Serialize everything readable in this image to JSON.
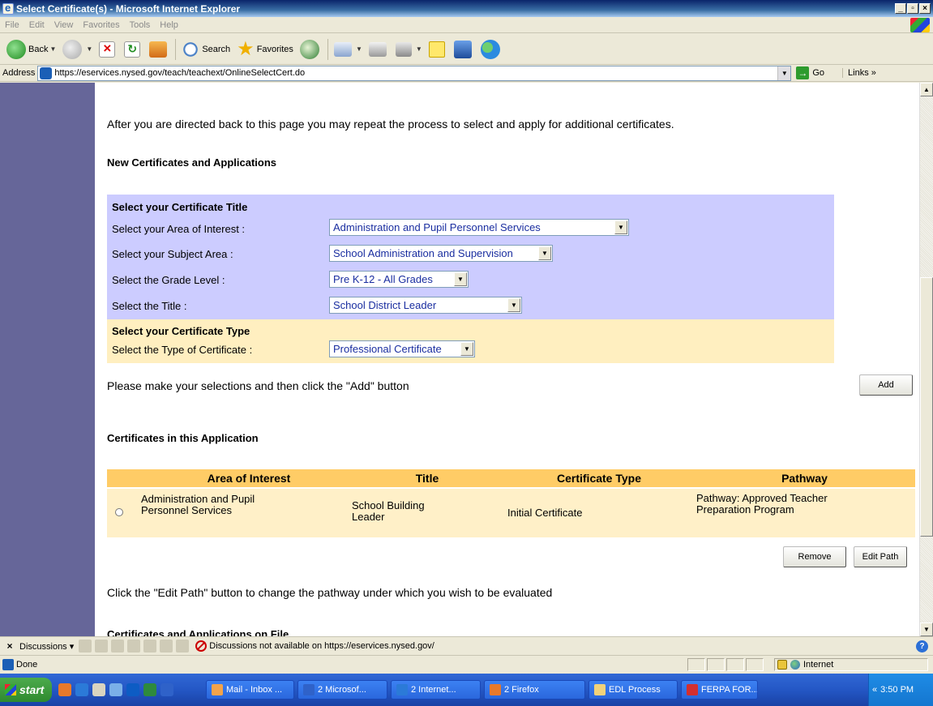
{
  "window": {
    "title": "Select Certificate(s) - Microsoft Internet Explorer",
    "min": "_",
    "max": "▫",
    "close": "×"
  },
  "menu": [
    "File",
    "Edit",
    "View",
    "Favorites",
    "Tools",
    "Help"
  ],
  "toolbar": {
    "back_label": "Back",
    "search_label": "Search",
    "favorites_label": "Favorites"
  },
  "address": {
    "label": "Address",
    "url": "https://eservices.nysed.gov/teach/teachext/OnlineSelectCert.do",
    "go_label": "Go",
    "links_label": "Links"
  },
  "page": {
    "intro": "After you are directed back to this page you may repeat the process to select and apply for additional certificates.",
    "new_heading": "New Certificates and Applications",
    "select_title_heading": "Select your Certificate Title",
    "area_label": "Select your Area of Interest :",
    "area_value": "Administration and Pupil Personnel Services",
    "subject_label": "Select your Subject Area :",
    "subject_value": "School Administration and Supervision",
    "grade_label": "Select the Grade Level :",
    "grade_value": "Pre K-12 - All Grades",
    "title_label": "Select the Title :",
    "title_value": "School District Leader",
    "select_type_heading": "Select your Certificate Type",
    "type_label": "Select the Type of Certificate :",
    "type_value": "Professional Certificate",
    "instructions": "Please make your selections and then click the \"Add\" button",
    "add_button": "Add",
    "in_app_heading": "Certificates in this Application",
    "table": {
      "headers": [
        "Area of Interest",
        "Title",
        "Certificate Type",
        "Pathway"
      ],
      "rows": [
        {
          "area": "Administration and Pupil Personnel Services",
          "title": "School Building Leader",
          "type": "Initial Certificate",
          "pathway": "Pathway: Approved Teacher Preparation Program"
        }
      ]
    },
    "remove_button": "Remove",
    "edit_path_button": "Edit Path",
    "edit_path_hint": "Click the \"Edit Path\" button to change the pathway under which you wish to be evaluated",
    "on_file_heading": "Certificates and Applications on File"
  },
  "discussions": {
    "label": "Discussions ▾",
    "message": "Discussions not available on https://eservices.nysed.gov/"
  },
  "status": {
    "text": "Done",
    "zone": "Internet"
  },
  "taskbar": {
    "start": "start",
    "items": [
      "Mail - Inbox ...",
      "2 Microsof...",
      "2 Internet...",
      "2 Firefox",
      "EDL Process",
      "FERPA FOR..."
    ],
    "clock": "3:50 PM"
  }
}
